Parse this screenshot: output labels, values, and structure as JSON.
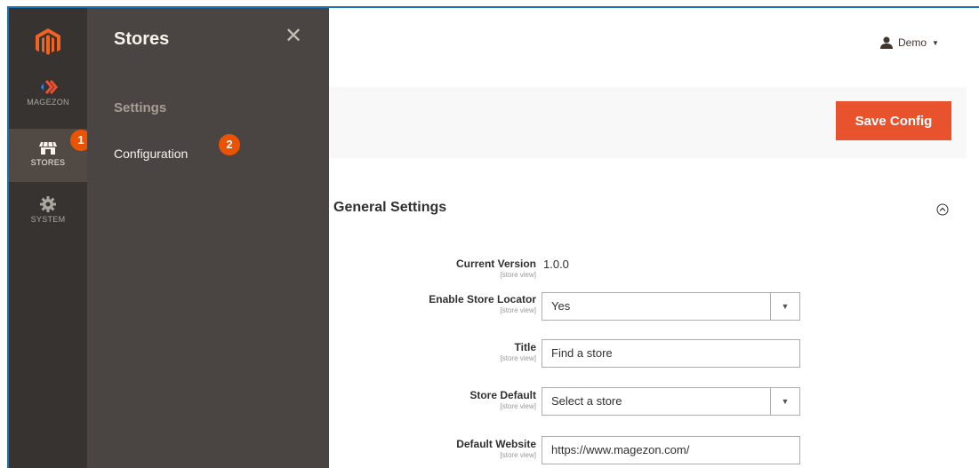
{
  "nav": {
    "magezon_label": "MAGEZON",
    "stores_label": "STORES",
    "system_label": "SYSTEM",
    "brand_color": "#eb5202"
  },
  "badges": {
    "one": "1",
    "two": "2"
  },
  "flyout": {
    "title": "Stores",
    "section": "Settings",
    "link": "Configuration"
  },
  "header": {
    "user": "Demo"
  },
  "actions": {
    "save_label": "Save Config"
  },
  "section": {
    "title": "General Settings"
  },
  "fields": [
    {
      "label": "Current Version",
      "scope": "[store view]",
      "value": "1.0.0"
    },
    {
      "label": "Enable Store Locator",
      "scope": "[store view]",
      "value": "Yes"
    },
    {
      "label": "Title",
      "scope": "[store view]",
      "value": "Find a store"
    },
    {
      "label": "Store Default",
      "scope": "[store view]",
      "value": "Select a store"
    },
    {
      "label": "Default Website",
      "scope": "[store view]",
      "value": "https://www.magezon.com/"
    }
  ]
}
